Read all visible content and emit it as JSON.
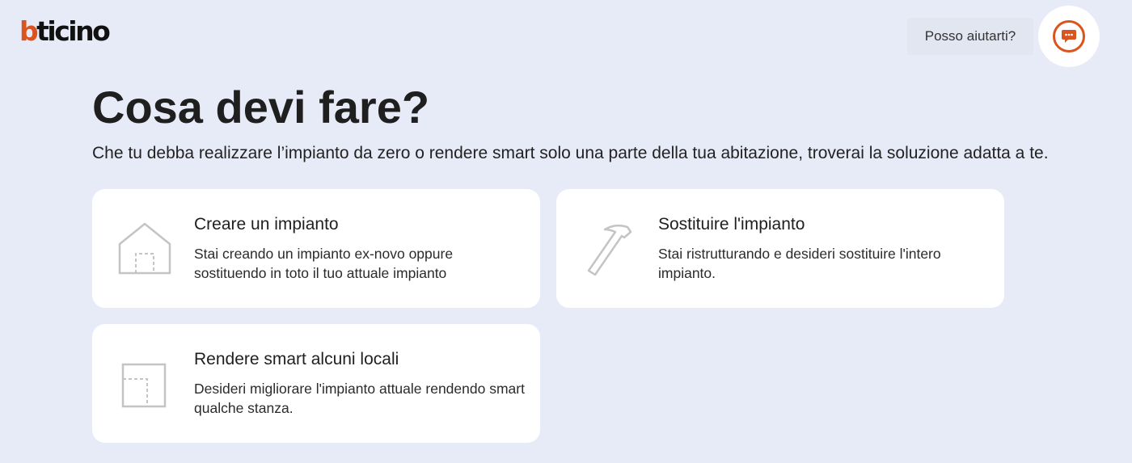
{
  "header": {
    "logo_b": "b",
    "logo_rest": "ticino",
    "help_label": "Posso aiutarti?",
    "chat_icon": "chat-bubble-icon",
    "brand_color": "#d9541e"
  },
  "main": {
    "title": "Cosa devi fare?",
    "subtitle": "Che tu debba realizzare l’impianto da zero o rendere smart solo una parte della tua abitazione, troverai la soluzione adatta a te."
  },
  "cards": [
    {
      "icon": "house-icon",
      "title": "Creare un impianto",
      "description": "Stai creando un impianto ex-novo oppure sostituendo in toto il tuo attuale impianto"
    },
    {
      "icon": "hammer-icon",
      "title": "Sostituire l'impianto",
      "description": "Stai ristrutturando e desideri sostituire l'intero impianto."
    },
    {
      "icon": "room-icon",
      "title": "Rendere smart alcuni locali",
      "description": "Desideri migliorare l'impianto attuale rendendo smart qualche stanza."
    }
  ]
}
